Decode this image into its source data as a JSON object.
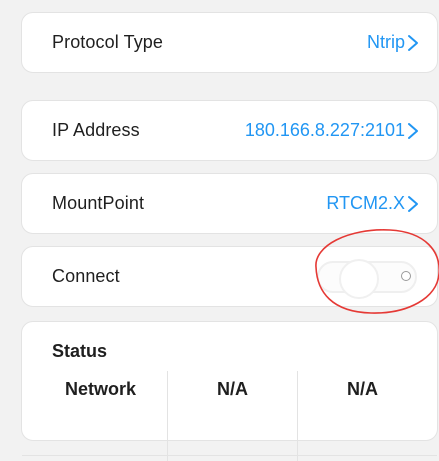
{
  "colors": {
    "background": "#f2f2f2",
    "card": "#ffffff",
    "accent": "#2196f3",
    "annotation": "#e53935"
  },
  "protocol": {
    "label": "Protocol Type",
    "value": "Ntrip",
    "chevron_icon": "chevron-right-icon"
  },
  "ip": {
    "label": "IP Address",
    "value": "180.166.8.227:2101",
    "chevron_icon": "chevron-right-icon"
  },
  "mountpoint": {
    "label": "MountPoint",
    "value": "RTCM2.X",
    "chevron_icon": "chevron-right-icon"
  },
  "connect": {
    "label": "Connect",
    "state": "off"
  },
  "status": {
    "title": "Status",
    "rows": [
      [
        "Network",
        "N/A",
        "N/A"
      ]
    ]
  }
}
